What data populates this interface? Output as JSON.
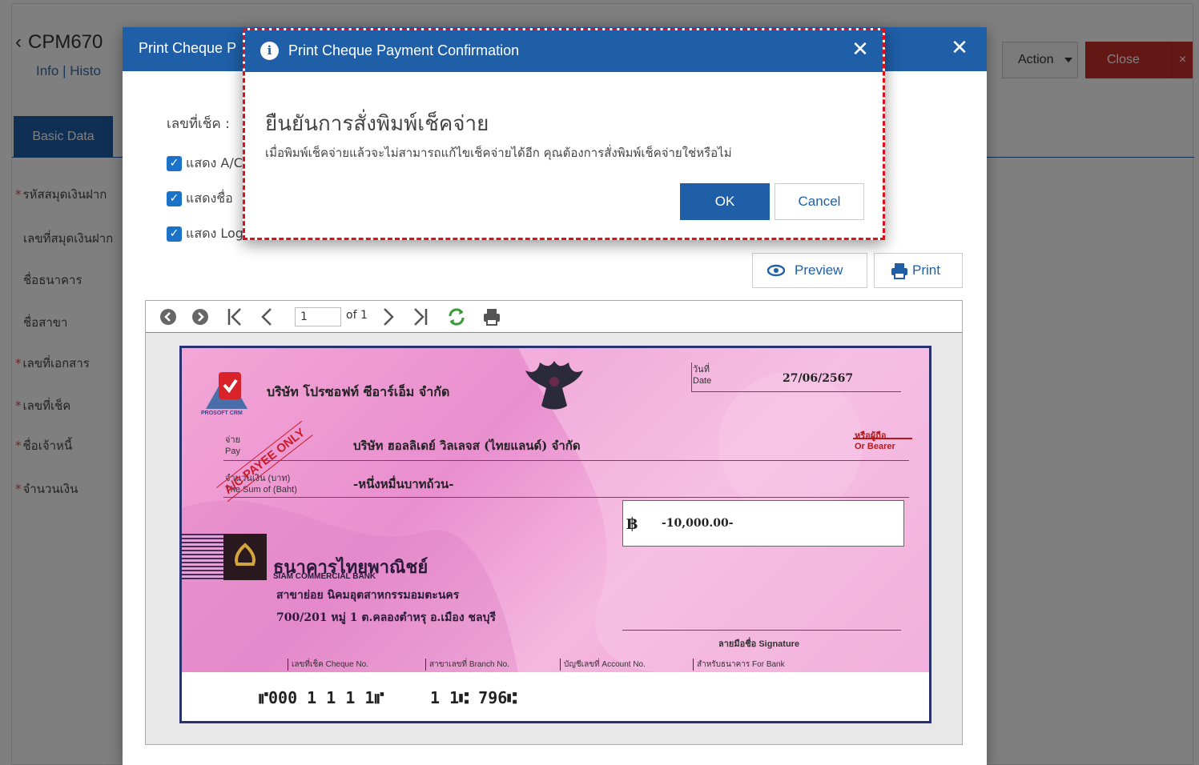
{
  "background": {
    "title": "CPM670",
    "subnav": "Info  |  Histo",
    "tab_basic": "Basic Data",
    "action_label": "Action",
    "close_label": "Close",
    "close_x": "×",
    "fields": [
      {
        "label": "รหัสสมุดเงินฝาก",
        "required": true
      },
      {
        "label": "เลขที่สมุดเงินฝาก",
        "required": false
      },
      {
        "label": "ชื่อธนาคาร",
        "required": false
      },
      {
        "label": "ชื่อสาขา",
        "required": false
      },
      {
        "label": "เลขที่เอกสาร",
        "required": true
      },
      {
        "label": "เลขที่เช็ค",
        "required": true
      },
      {
        "label": "ชื่อเจ้าหนี้",
        "required": true
      },
      {
        "label": "จำนวนเงิน",
        "required": true
      }
    ]
  },
  "modal": {
    "title": "Print Cheque P",
    "close_icon": "close-icon",
    "cheque_no_label": "เลขที่เช็ค :",
    "checkboxes": [
      {
        "label": "แสดง A/C",
        "checked": true
      },
      {
        "label": "แสดงชื่อ",
        "checked": true
      },
      {
        "label": "แสดง Log",
        "checked": true
      }
    ],
    "preview_label": "Preview",
    "print_label": "Print"
  },
  "viewer": {
    "page_value": "1",
    "of_label": "of 1"
  },
  "cheque": {
    "company": "บริษัท โปรซอฟท์ ซีอาร์เอ็ม จำกัด",
    "logo_text": "PROSOFT CRM",
    "date_th": "วันที่",
    "date_en": "Date",
    "date_value": "27/06/2567",
    "pay_th": "จ่าย",
    "pay_en": "Pay",
    "payee": "บริษัท ฮอลลิเดย์ วิลเลจส (ไทยแลนด์) จำกัด",
    "or_bearer_th": "หรือผู้ถือ",
    "or_bearer_en": "Or Bearer",
    "sum_th": "จำนวนเงิน (บาท)",
    "sum_en": "The Sum of (Baht)",
    "amount_words": "-หนึ่งหมื่นบาทถ้วน-",
    "stamp": "A/C PAYEE ONLY",
    "baht_symbol": "฿",
    "amount": "-10,000.00-",
    "bank_th": "ธนาคารไทยพาณิชย์",
    "bank_en": "SIAM COMMERCIAL BANK",
    "branch": "สาขาย่อย นิคมอุตสาหกรรมอมตะนคร",
    "address": "700/201 หมู่ 1 ต.คลองตำหรุ อ.เมือง ชลบุรี",
    "signature": "ลายมือชื่อ Signature",
    "cheque_no_caption": "เลขที่เช็ค Cheque No.",
    "branch_no_caption": "สาขาเลขที่ Branch No.",
    "account_no_caption": "บัญชีเลขที่ Account No.",
    "for_bank_caption": "สำหรับธนาคาร For Bank",
    "micr_cheque": "⑈000 1 1 1 1⑈",
    "micr_branch": "1 1⑆ 796⑆"
  },
  "confirm": {
    "title": "Print Cheque Payment Confirmation",
    "heading": "ยืนยันการสั่งพิมพ์เช็คจ่าย",
    "message": "เมื่อพิมพ์เช็คจ่ายแล้วจะไม่สามารถแก้ไขเช็คจ่ายได้อีก คุณต้องการสั่งพิมพ์เช็คจ่ายใช่หรือไม่",
    "ok_label": "OK",
    "cancel_label": "Cancel",
    "close_icon": "close-icon",
    "info_icon": "info-icon"
  },
  "colors": {
    "primary": "#1f5fa8",
    "danger": "#c9302c",
    "highlight_border": "#d9131b",
    "cheque_pink": "#ea94d2"
  }
}
